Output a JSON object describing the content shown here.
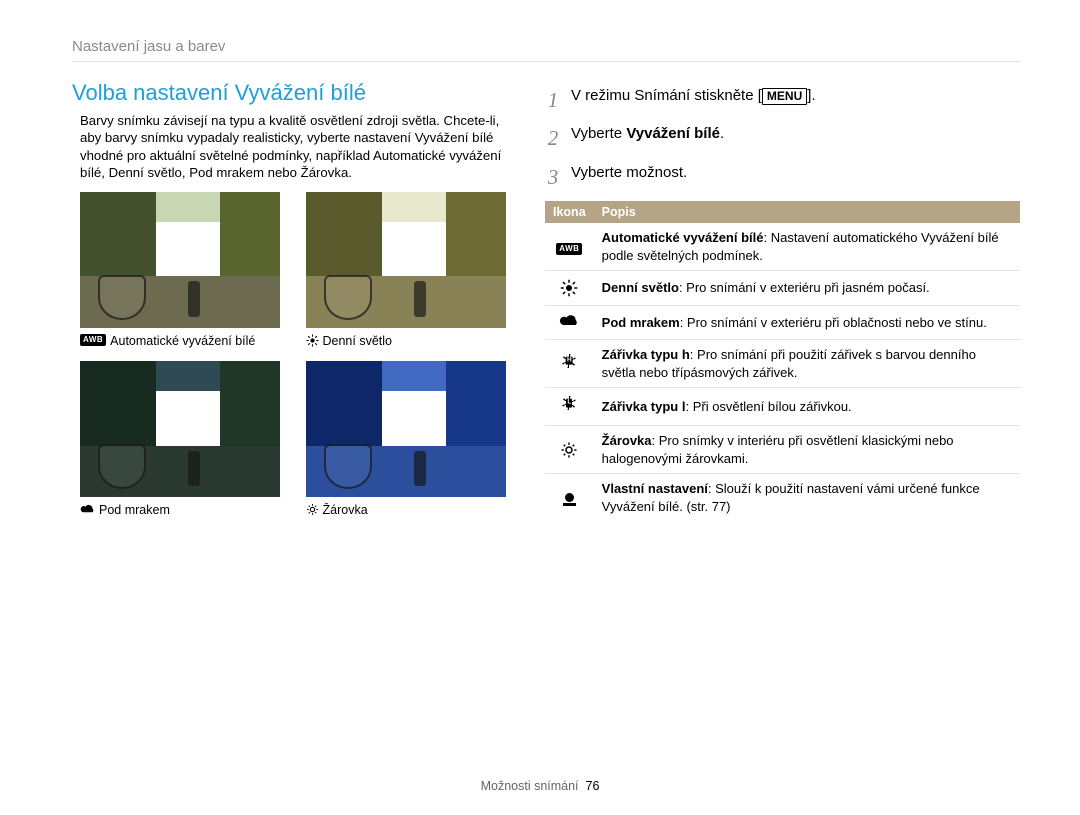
{
  "breadcrumb": "Nastavení jasu a barev",
  "title": "Volba nastavení Vyvážení bílé",
  "intro": "Barvy snímku závisejí na typu a kvalitě osvětlení zdroji světla. Chcete-li, aby barvy snímku vypadaly realisticky, vyberte nastavení Vyvážení bílé vhodné pro aktuální světelné podmínky, například Automatické vyvážení bílé, Denní světlo, Pod mrakem nebo Žárovka.",
  "examples": [
    {
      "id": "awb",
      "label": "Automatické vyvážení bílé",
      "icon": "awb"
    },
    {
      "id": "day",
      "label": "Denní světlo",
      "icon": "sun"
    },
    {
      "id": "cld",
      "label": "Pod mrakem",
      "icon": "cloud"
    },
    {
      "id": "tng",
      "label": "Žárovka",
      "icon": "bulb"
    }
  ],
  "steps": {
    "s1_a": "V režimu Snímání stiskněte ",
    "s1_menu": "MENU",
    "s1_b": ".",
    "s2_a": "Vyberte ",
    "s2_bold": "Vyvážení bílé",
    "s2_b": ".",
    "s3": "Vyberte možnost."
  },
  "table": {
    "head_icon": "Ikona",
    "head_desc": "Popis",
    "rows": [
      {
        "icon": "awb",
        "bold": "Automatické vyvážení bílé",
        "rest": ": Nastavení automatického Vyvážení bílé podle světelných podmínek."
      },
      {
        "icon": "sun",
        "bold": "Denní světlo",
        "rest": ": Pro snímání v exteriéru při jasném počasí."
      },
      {
        "icon": "cloud",
        "bold": "Pod mrakem",
        "rest": ": Pro snímání v exteriéru při oblačnosti nebo ve stínu."
      },
      {
        "icon": "fl-h",
        "bold": "Zářivka typu h",
        "rest": ": Pro snímání při použití zářivek s barvou denního světla nebo třípásmových zářivek."
      },
      {
        "icon": "fl-l",
        "bold": "Zářivka typu l",
        "rest": ": Při osvětlení bílou zářivkou."
      },
      {
        "icon": "bulb",
        "bold": "Žárovka",
        "rest": ": Pro snímky v interiéru při osvětlení klasickými nebo halogenovými žárovkami."
      },
      {
        "icon": "custom",
        "bold": "Vlastní nastavení",
        "rest": ": Slouží k použití nastavení vámi určené funkce Vyvážení bílé. (str. 77)"
      }
    ]
  },
  "footer": {
    "section": "Možnosti snímání",
    "page": "76"
  }
}
